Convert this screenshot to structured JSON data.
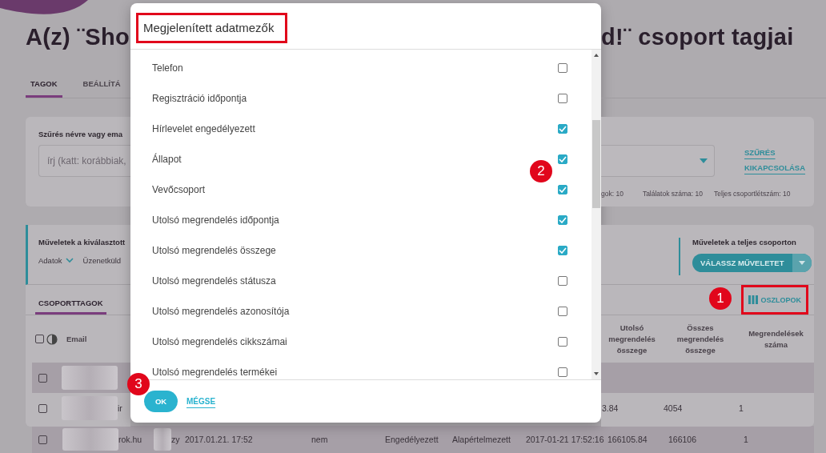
{
  "header": {
    "title_start": "A(z) ¨Sho",
    "title_end": "d!¨ csoport tagjai"
  },
  "tabs": [
    {
      "label": "TAGOK",
      "selected": true
    },
    {
      "label": "BEÁLLÍTÁ",
      "selected": false
    }
  ],
  "filter": {
    "label": "Szűrés névre vagy ema",
    "placeholder": "írj (katt: korábbiak,",
    "clear_link": "SZŰRÉS KIKAPCSOLÁSA",
    "stats": [
      "gok: 10",
      "Találatok száma: 10",
      "Teljes csoportlétszám: 10"
    ]
  },
  "actions": {
    "selected_title": "Műveletek a kiválasztott",
    "menu": [
      {
        "label": "Adatok",
        "kind": "dropdown"
      },
      {
        "label": "Üzenetküld",
        "kind": "plain"
      }
    ],
    "group_title": "Műveletek a teljes csoporton",
    "group_button": "VÁLASSZ MŰVELETET"
  },
  "member_tabs": [
    {
      "label": "CSOPORTTAGOK",
      "selected": true
    }
  ],
  "columns_button": "OSZLOPOK",
  "table": {
    "select_all_checked": false,
    "email_header": "Email",
    "headers": [
      "Utolsó megrendelés összege",
      "Összes megrendelés összege",
      "Megrendelések száma"
    ],
    "rows": [
      {
        "highlighted": true,
        "checked": false
      },
      {
        "highlighted": false,
        "checked": false,
        "email_fragment": "ir",
        "values": [
          "3.84",
          "4054",
          "1"
        ]
      }
    ],
    "bottom_row": {
      "highlighted": true,
      "checked": false,
      "cells": [
        "rok.hu",
        "zy",
        "2017.01.21. 17:52",
        "nem",
        "Engedélyezett",
        "Alapértelmezett",
        "2017-01-21 17:52:16",
        "166105.84",
        "166106",
        "1"
      ]
    }
  },
  "dialog": {
    "title": "Megjelenített adatmezők",
    "fields": [
      {
        "label": "Telefon",
        "checked": false
      },
      {
        "label": "Regisztráció időpontja",
        "checked": false
      },
      {
        "label": "Hírlevelet engedélyezett",
        "checked": true
      },
      {
        "label": "Állapot",
        "checked": true
      },
      {
        "label": "Vevőcsoport",
        "checked": true
      },
      {
        "label": "Utolsó megrendelés időpontja",
        "checked": true
      },
      {
        "label": "Utolsó megrendelés összege",
        "checked": true
      },
      {
        "label": "Utolsó megrendelés státusza",
        "checked": false
      },
      {
        "label": "Utolsó megrendelés azonosítója",
        "checked": false
      },
      {
        "label": "Utolsó megrendelés cikkszámai",
        "checked": false
      },
      {
        "label": "Utolsó megrendelés termékei",
        "checked": false
      }
    ],
    "ok": "OK",
    "cancel": "MÉGSE"
  },
  "annotations": [
    "1",
    "2",
    "3"
  ]
}
